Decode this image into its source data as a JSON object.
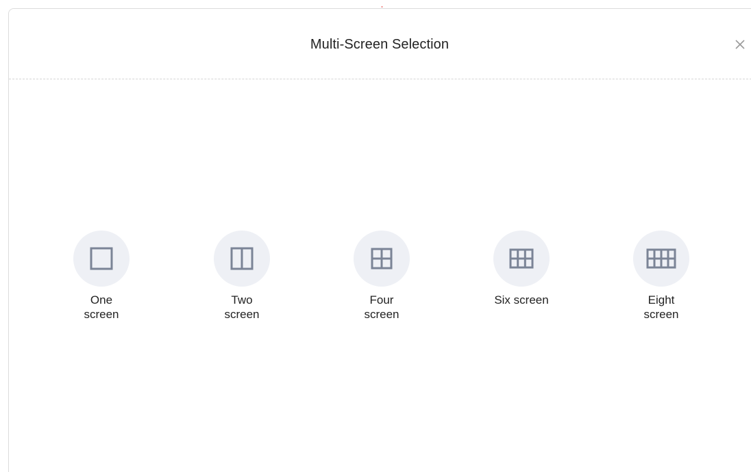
{
  "dialog": {
    "title": "Multi-Screen Selection",
    "close_label": "×"
  },
  "layouts": [
    {
      "label": "One screen",
      "icon": "one-screen-icon"
    },
    {
      "label": "Two screen",
      "icon": "two-screen-icon"
    },
    {
      "label": "Four screen",
      "icon": "four-screen-icon"
    },
    {
      "label": "Six screen",
      "icon": "six-screen-icon"
    },
    {
      "label": "Eight screen",
      "icon": "eight-screen-icon"
    }
  ],
  "colors": {
    "icon_stroke": "#7b8496",
    "icon_circle_bg": "#eef0f5",
    "divider": "#d4d4d4",
    "text": "#222222"
  }
}
